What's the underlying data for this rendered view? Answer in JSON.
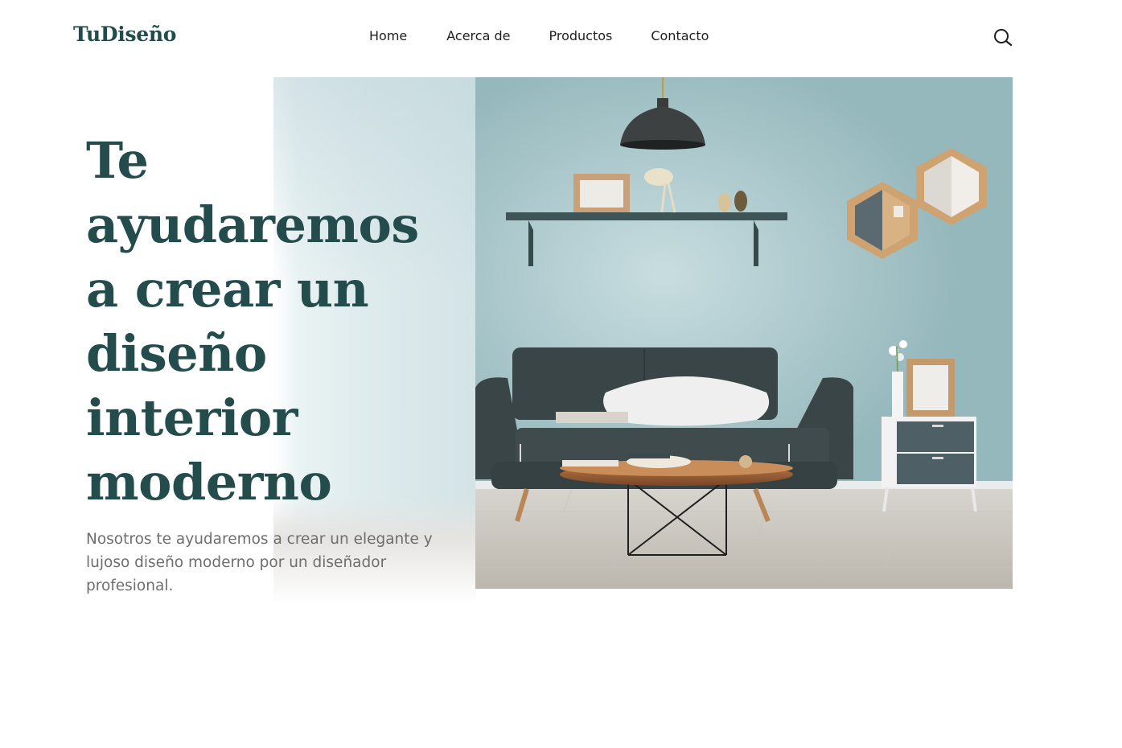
{
  "header": {
    "logo": "TuDiseño",
    "nav": [
      {
        "label": "Home"
      },
      {
        "label": "Acerca de"
      },
      {
        "label": "Productos"
      },
      {
        "label": "Contacto"
      }
    ],
    "search_icon": "search-icon"
  },
  "hero": {
    "title": "Te ayudaremos a crear un diseño interior moderno",
    "description": "Nosotros te ayudaremos a crear un elegante y lujoso diseño moderno por un diseñador profesional.",
    "image": "living-room-photo"
  },
  "colors": {
    "brand": "#244c4c",
    "text_muted": "#6e6e6e",
    "wall": "#9fc0c3",
    "sofa": "#3d4a4c"
  }
}
